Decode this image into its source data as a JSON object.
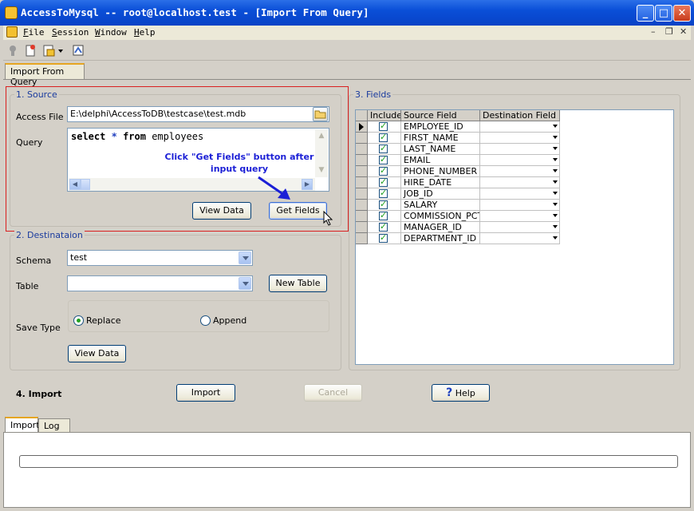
{
  "window": {
    "title": "AccessToMysql -- root@localhost.test - [Import From Query]",
    "accent": "#0a4fd8"
  },
  "menu": {
    "items": [
      "File",
      "Session",
      "Window",
      "Help"
    ]
  },
  "tabs": {
    "top": "Import From Query",
    "bottom": [
      "Import",
      "Log"
    ]
  },
  "source": {
    "legend": "1. Source",
    "access_file_label": "Access File",
    "access_file_value": "E:\\delphi\\AccessToDB\\testcase\\test.mdb",
    "query_label": "Query",
    "query_keyword_select": "select",
    "query_star": "*",
    "query_keyword_from": "from",
    "query_table": "employees",
    "annotation_line1": "Click \"Get Fields\" button after",
    "annotation_line2": "input query",
    "view_data": "View Data",
    "get_fields": "Get Fields",
    "highlight_color": "#d92020"
  },
  "destination": {
    "legend": "2. Destinataion",
    "schema_label": "Schema",
    "schema_value": "test",
    "table_label": "Table",
    "table_value": "",
    "new_table": "New Table",
    "save_type_label": "Save Type",
    "replace": "Replace",
    "append": "Append",
    "view_data": "View Data"
  },
  "fields": {
    "legend": "3. Fields",
    "columns": [
      "Include",
      "Source Field",
      "Destination Field"
    ],
    "rows": [
      "EMPLOYEE_ID",
      "FIRST_NAME",
      "LAST_NAME",
      "EMAIL",
      "PHONE_NUMBER",
      "HIRE_DATE",
      "JOB_ID",
      "SALARY",
      "COMMISSION_PCT",
      "MANAGER_ID",
      "DEPARTMENT_ID"
    ]
  },
  "import": {
    "label": "4. Import",
    "import_button": "Import",
    "cancel_button": "Cancel",
    "help_button": "Help"
  }
}
